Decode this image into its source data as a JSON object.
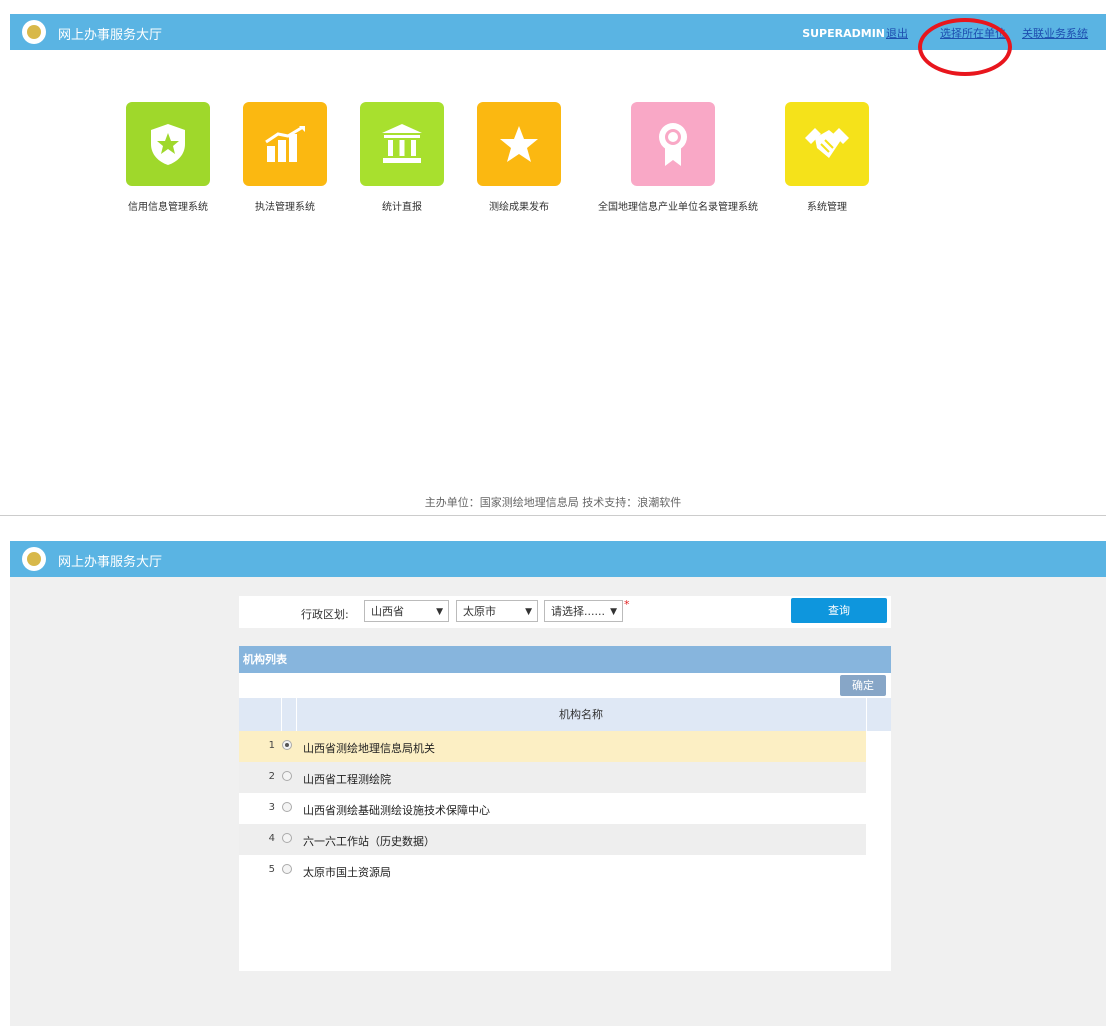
{
  "header_top": {
    "title": "网上办事服务大厅",
    "user": "SUPERADMIN",
    "logout": "退出",
    "select_unit": "选择所在单位",
    "related_system": "关联业务系统"
  },
  "apps": [
    {
      "label": "信用信息管理系统",
      "icon": "shield-star-icon",
      "color": "#9fd82b"
    },
    {
      "label": "执法管理系统",
      "icon": "bar-chart-icon",
      "color": "#fbb811"
    },
    {
      "label": "统计直报",
      "icon": "bank-icon",
      "color": "#a8e02e"
    },
    {
      "label": "测绘成果发布",
      "icon": "star-icon",
      "color": "#fbb811"
    },
    {
      "label": "全国地理信息产业单位名录管理系统",
      "icon": "award-ribbon-icon",
      "color": "#f9a8c6"
    },
    {
      "label": "系统管理",
      "icon": "handshake-icon",
      "color": "#f5e21a"
    }
  ],
  "footer": "主办单位：国家测绘地理信息局 技术支持：浪潮软件",
  "header_bottom": {
    "title": "网上办事服务大厅"
  },
  "filter": {
    "label": "行政区划:",
    "province": "山西省",
    "city": "太原市",
    "district": "请选择......",
    "required_mark": "*",
    "query_button": "查询"
  },
  "org_list": {
    "title": "机构列表",
    "confirm_button": "确定",
    "column_header": "机构名称",
    "rows": [
      {
        "num": "1",
        "name": "山西省测绘地理信息局机关",
        "selected": true
      },
      {
        "num": "2",
        "name": "山西省工程测绘院",
        "selected": false
      },
      {
        "num": "3",
        "name": "山西省测绘基础测绘设施技术保障中心",
        "selected": false
      },
      {
        "num": "4",
        "name": "六一六工作站（历史数据）",
        "selected": false
      },
      {
        "num": "5",
        "name": "太原市国土资源局",
        "selected": false
      }
    ]
  }
}
